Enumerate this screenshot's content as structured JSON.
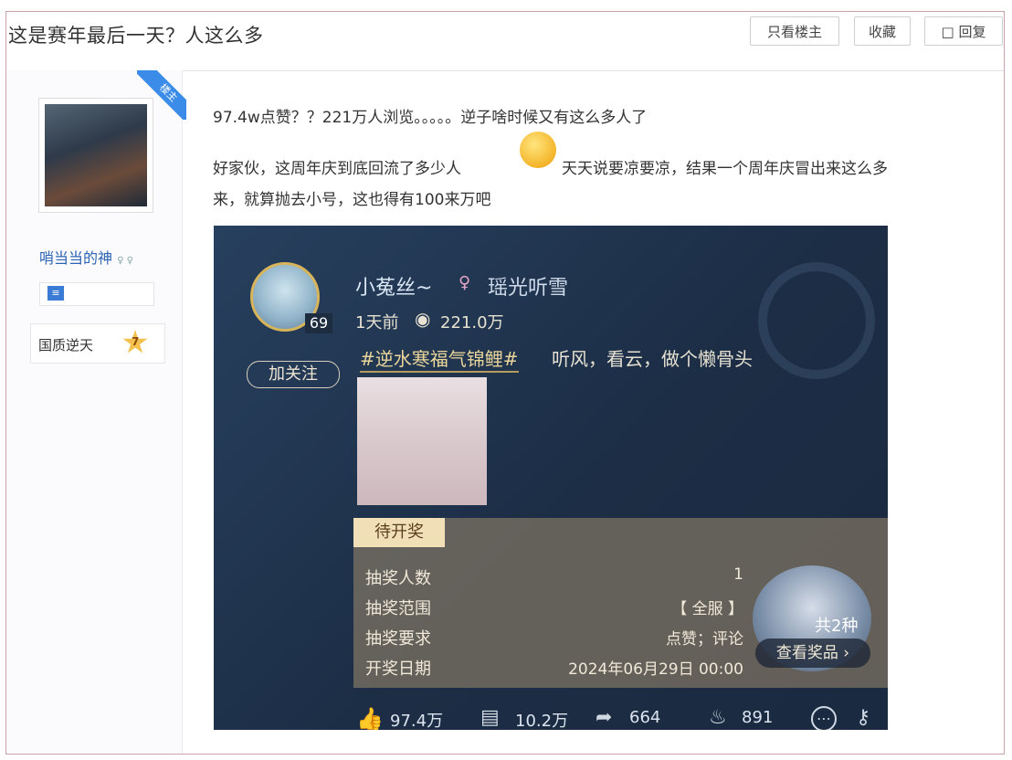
{
  "post": {
    "title": "这是赛年最后一天？人这么多",
    "buttons": {
      "author_only": "只看楼主",
      "favorite": "收藏",
      "reply": "回复"
    }
  },
  "author": {
    "badge": "楼主",
    "name": "哨当当的神",
    "title_tag": "国质逆天",
    "level": "7"
  },
  "content": {
    "line1": "97.4w点赞？？221万人浏览。。。。。逆子啥时候又有这么多人了",
    "line2_a": "好家伙，这周年庆到底回流了多少人",
    "line2_b": "天天说要凉要凉，结果一个周年庆冒出来这么多",
    "line3": "来，就算抛去小号，这也得有100来万吧"
  },
  "screenshot": {
    "user_name": "小菟丝~",
    "server": "瑶光听雪",
    "level": "69",
    "follow": "加关注",
    "time": "1天前",
    "views": "221.0万",
    "hashtag": "#逆水寒福气锦鲤#",
    "post_text": "听风，看云，做个懒骨头",
    "lottery": {
      "status": "待开奖",
      "rows": [
        {
          "label": "抽奖人数",
          "value": "1"
        },
        {
          "label": "抽奖范围",
          "value": "【 全服 】"
        },
        {
          "label": "抽奖要求",
          "value": "点赞；评论"
        },
        {
          "label": "开奖日期",
          "value": "2024年06月29日 00:00"
        }
      ],
      "prize_count": "共2种",
      "view_prizes": "查看奖品"
    },
    "stats": {
      "likes": "97.4万",
      "comments": "10.2万",
      "shares": "664",
      "gifts": "891"
    }
  }
}
